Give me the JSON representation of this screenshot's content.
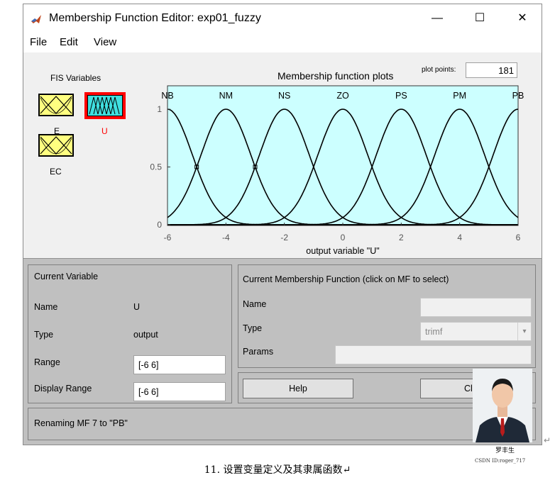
{
  "window": {
    "title": "Membership Function Editor: exp01_fuzzy",
    "controls": {
      "minimize": "—",
      "maximize": "☐",
      "close": "✕"
    }
  },
  "menu": [
    "File",
    "Edit",
    "View"
  ],
  "fis_variables": {
    "heading": "FIS Variables",
    "inputs": [
      "E",
      "EC"
    ],
    "outputs": [
      "U"
    ],
    "selected": "U"
  },
  "plot": {
    "title": "Membership function plots",
    "plot_points_label": "plot points:",
    "plot_points_value": "181"
  },
  "chart_data": {
    "type": "line",
    "title": "Membership function plots",
    "xlabel": "output variable \"U\"",
    "ylabel": "",
    "xlim": [
      -6,
      6
    ],
    "ylim": [
      0,
      1
    ],
    "x_ticks": [
      "-6",
      "-4",
      "-2",
      "0",
      "2",
      "4",
      "6"
    ],
    "y_ticks": [
      "0",
      "0.5",
      "1"
    ],
    "series": [
      {
        "name": "NB",
        "shape": "gaussian",
        "center": -6,
        "sigma": 0.85
      },
      {
        "name": "NM",
        "shape": "gaussian",
        "center": -4,
        "sigma": 0.85
      },
      {
        "name": "NS",
        "shape": "gaussian",
        "center": -2,
        "sigma": 0.85
      },
      {
        "name": "ZO",
        "shape": "gaussian",
        "center": 0,
        "sigma": 0.85
      },
      {
        "name": "PS",
        "shape": "gaussian",
        "center": 2,
        "sigma": 0.85
      },
      {
        "name": "PM",
        "shape": "gaussian",
        "center": 4,
        "sigma": 0.85
      },
      {
        "name": "PB",
        "shape": "gaussian",
        "center": 6,
        "sigma": 0.85
      }
    ],
    "background": "#ccffff",
    "grid": false
  },
  "current_variable": {
    "heading": "Current Variable",
    "name_label": "Name",
    "name_value": "U",
    "type_label": "Type",
    "type_value": "output",
    "range_label": "Range",
    "range_value": "[-6 6]",
    "display_range_label": "Display Range",
    "display_range_value": "[-6 6]"
  },
  "current_mf": {
    "heading": "Current Membership Function (click on MF to select)",
    "name_label": "Name",
    "name_value": "",
    "type_label": "Type",
    "type_value": "trimf",
    "params_label": "Params",
    "params_value": ""
  },
  "buttons": {
    "help": "Help",
    "close": "Close"
  },
  "status": "Renaming MF 7 to \"PB\"",
  "overlay": {
    "signature": "罗丰生",
    "watermark": "CSDN ID:roger_717",
    "return_mark": "↵"
  },
  "caption": "11. 设置变量定义及其隶属函数↵",
  "colors": {
    "input_var": "#ffff80",
    "output_var": "#80ffff",
    "selected_border": "#ff0000",
    "plot_bg": "#ccffff",
    "panel": "#c0c0c0"
  }
}
